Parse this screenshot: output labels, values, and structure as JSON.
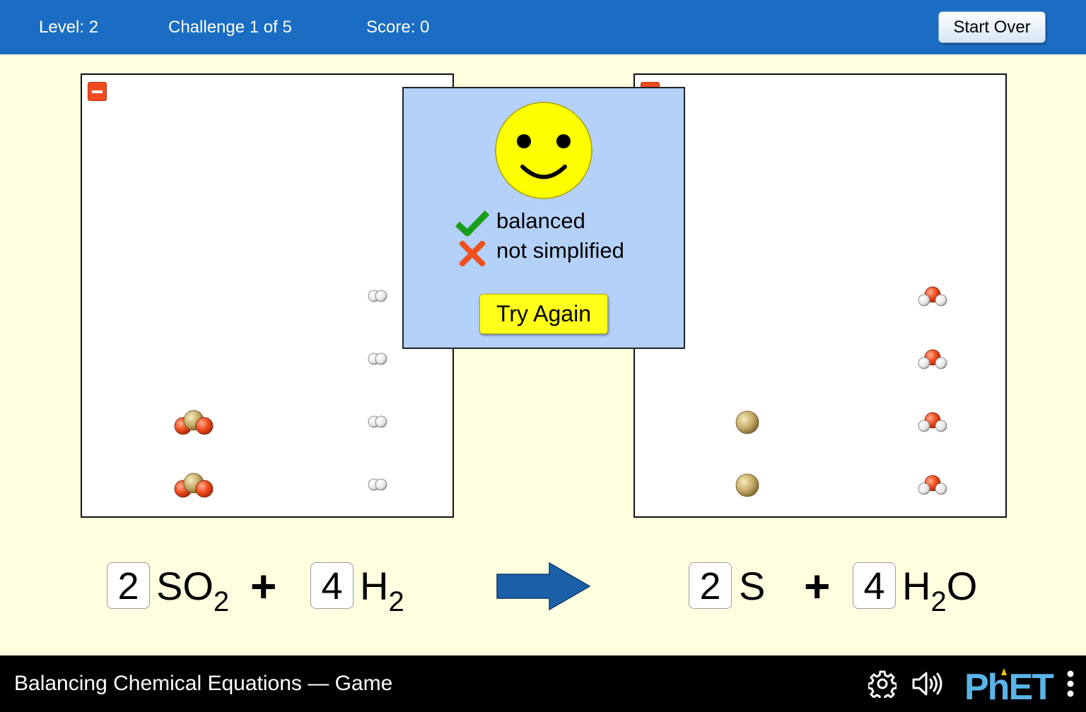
{
  "header": {
    "level": "Level: 2",
    "challenge": "Challenge 1 of 5",
    "score": "Score: 0",
    "start_over": "Start Over"
  },
  "popup": {
    "balanced": "balanced",
    "not_simplified": "not simplified",
    "try_again": "Try Again"
  },
  "equation": {
    "reactants": [
      {
        "coefficient": "2",
        "element": "SO",
        "subscript": "2"
      },
      {
        "coefficient": "4",
        "element": "H",
        "subscript": "2"
      }
    ],
    "products": [
      {
        "coefficient": "2",
        "element": "S"
      },
      {
        "coefficient": "4",
        "element": "H",
        "subscript": "2",
        "suffix": "O"
      }
    ],
    "plus": "+"
  },
  "footer": {
    "title": "Balancing Chemical Equations — Game",
    "brand": "PhET"
  },
  "colors": {
    "header_bg": "#1a6dc2",
    "play_area_bg": "#ffffe0",
    "popup_bg": "#b4d1f9",
    "try_again_bg": "#ffff1a",
    "check_green": "#1a9e1a",
    "cross_orange": "#f0501e",
    "arrow_blue": "#1a5fa8"
  }
}
